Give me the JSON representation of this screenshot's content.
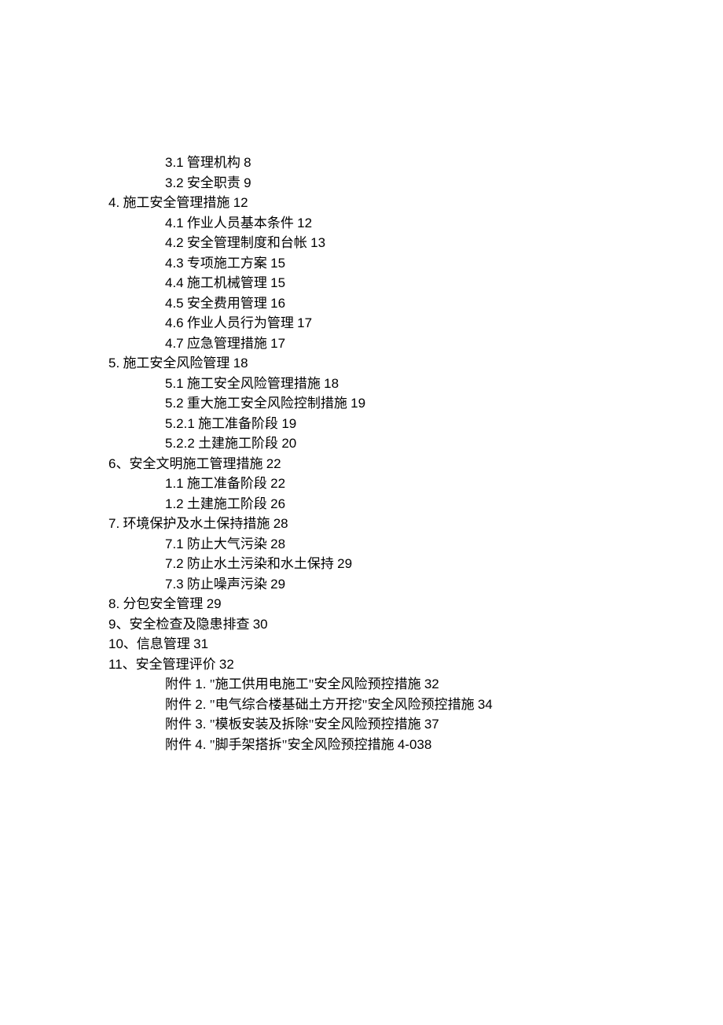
{
  "toc": [
    {
      "level": 2,
      "text": "3.1  管理机构  8"
    },
    {
      "level": 2,
      "text": "3.2  安全职责  9"
    },
    {
      "level": 1,
      "text": "4.  施工安全管理措施  12"
    },
    {
      "level": 2,
      "text": "4.1  作业人员基本条件  12"
    },
    {
      "level": 2,
      "text": "4.2  安全管理制度和台帐  13"
    },
    {
      "level": 2,
      "text": "4.3 专项施工方案  15"
    },
    {
      "level": 2,
      "text": "4.4  施工机械管理  15"
    },
    {
      "level": 2,
      "text": "4.5  安全费用管理  16"
    },
    {
      "level": 2,
      "text": "4.6  作业人员行为管理  17"
    },
    {
      "level": 2,
      "text": "4.7  应急管理措施  17"
    },
    {
      "level": 1,
      "text": "5.  施工安全风险管理  18"
    },
    {
      "level": 2,
      "text": "5.1  施工安全风险管理措施  18"
    },
    {
      "level": 2,
      "text": "5.2  重大施工安全风险控制措施 19"
    },
    {
      "level": 2,
      "text": "5.2.1   施工准备阶段  19"
    },
    {
      "level": 2,
      "text": "5.2.2   土建施工阶段  20"
    },
    {
      "level": 1,
      "text": "6、安全文明施工管理措施  22"
    },
    {
      "level": 2,
      "text": "1.1  施工准备阶段  22"
    },
    {
      "level": 2,
      "text": "1.2  土建施工阶段  26"
    },
    {
      "level": 1,
      "text": "7.  环境保护及水土保持措施  28"
    },
    {
      "level": 2,
      "text": "7.1  防止大气污染  28"
    },
    {
      "level": 2,
      "text": "7.2  防止水土污染和水土保持 29"
    },
    {
      "level": 2,
      "text": "7.3  防止噪声污染  29"
    },
    {
      "level": 1,
      "text": "8.  分包安全管理  29"
    },
    {
      "level": 1,
      "text": "9、安全检查及隐患排查  30"
    },
    {
      "level": 1,
      "text": "10、信息管理  31"
    },
    {
      "level": 1,
      "text": "11、安全管理评价  32"
    },
    {
      "level": 2,
      "text": "附件 1.  \"施工供用电施工\"安全风险预控措施  32"
    },
    {
      "level": 2,
      "text": "附件 2.  \"电气综合楼基础土方开挖\"安全风险预控措施  34"
    },
    {
      "level": 2,
      "text": "附件 3.  \"模板安装及拆除\"安全风险预控措施  37"
    },
    {
      "level": 2,
      "text": "附件  4.  \"脚手架搭拆\"安全风险预控措施  4-038"
    }
  ]
}
